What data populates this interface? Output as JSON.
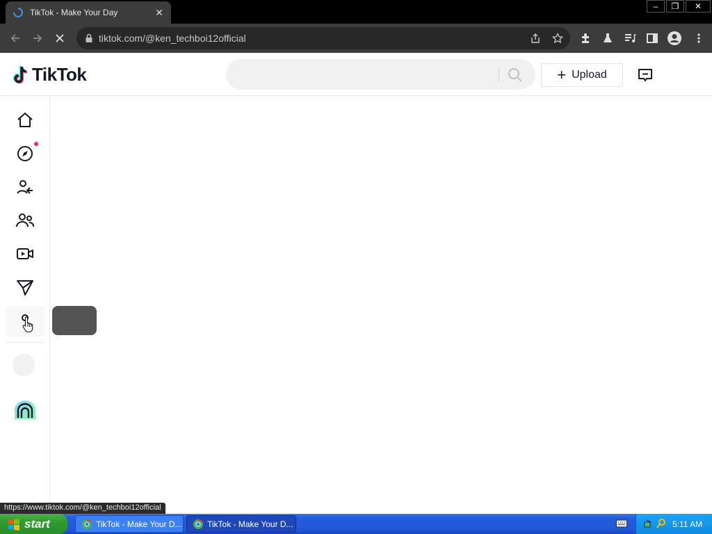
{
  "browser": {
    "tab_title": "TikTok - Make Your Day",
    "url": "tiktok.com/@ken_techboi12official",
    "status_url": "https://www.tiktok.com/@ken_techboi12official"
  },
  "header": {
    "logo_text": "TikTok",
    "search_placeholder": "",
    "upload_label": "Upload"
  },
  "sidebar": {
    "items": [
      "home-icon",
      "explore-icon",
      "following-icon",
      "friends-icon",
      "live-icon",
      "messages-icon",
      "profile-icon"
    ]
  },
  "taskbar": {
    "start_label": "start",
    "tasks": [
      {
        "label": "TikTok - Make Your D..."
      },
      {
        "label": "TikTok - Make Your D..."
      }
    ],
    "clock": "5:11 AM"
  },
  "colors": {
    "tiktok_red": "#fe2c55",
    "tiktok_cyan": "#25f4ee",
    "chrome_dark": "#3c3c3c"
  }
}
